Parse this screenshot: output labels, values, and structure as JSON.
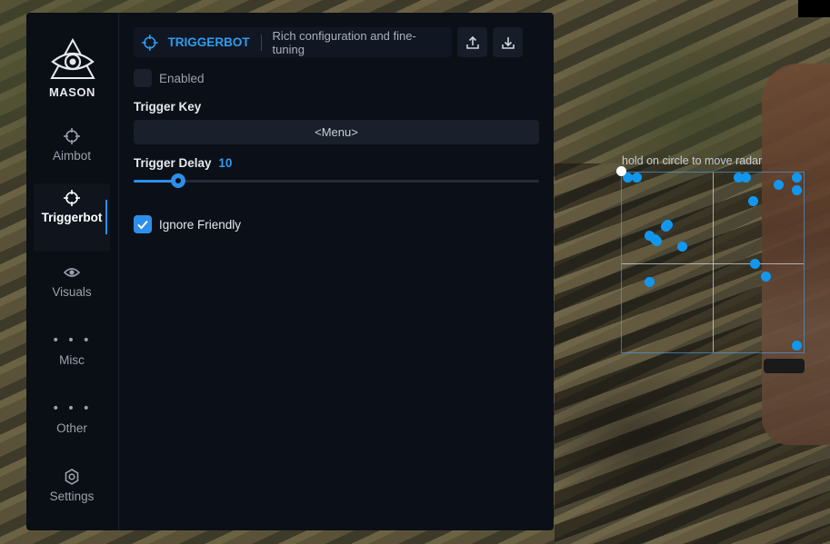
{
  "app": {
    "name": "MASON"
  },
  "sidebar": {
    "items": [
      {
        "label": "Aimbot",
        "icon": "crosshair-icon",
        "active": false
      },
      {
        "label": "Triggerbot",
        "icon": "crosshair-icon",
        "active": true
      },
      {
        "label": "Visuals",
        "icon": "eye-icon",
        "active": false
      },
      {
        "label": "Misc",
        "icon": "dots-icon",
        "active": false
      },
      {
        "label": "Other",
        "icon": "dots-icon",
        "active": false
      },
      {
        "label": "Settings",
        "icon": "gear-icon",
        "active": false
      }
    ]
  },
  "header": {
    "title": "TRIGGERBOT",
    "subtitle": "Rich configuration and fine-tuning",
    "upload_icon": "upload-icon",
    "download_icon": "download-icon"
  },
  "settings": {
    "enabled": {
      "label": "Enabled",
      "checked": false
    },
    "trigger_key": {
      "label": "Trigger Key",
      "value": "<Menu>"
    },
    "trigger_delay": {
      "label": "Trigger Delay",
      "value": "10",
      "fraction": 0.11
    },
    "ignore_friendly": {
      "label": "Ignore Friendly",
      "checked": true
    }
  },
  "radar": {
    "hint": "hold on circle to move radar",
    "accent": "#1297ee",
    "blips": [
      [
        0.03,
        0.03
      ],
      [
        0.08,
        0.03
      ],
      [
        0.64,
        0.03
      ],
      [
        0.68,
        0.03
      ],
      [
        0.86,
        0.07
      ],
      [
        0.96,
        0.03
      ],
      [
        0.96,
        0.1
      ],
      [
        0.72,
        0.16
      ],
      [
        0.25,
        0.29
      ],
      [
        0.24,
        0.3
      ],
      [
        0.15,
        0.35
      ],
      [
        0.18,
        0.37
      ],
      [
        0.19,
        0.38
      ],
      [
        0.33,
        0.41
      ],
      [
        0.73,
        0.51
      ],
      [
        0.79,
        0.58
      ],
      [
        0.15,
        0.61
      ],
      [
        0.96,
        0.96
      ]
    ]
  },
  "colors": {
    "accent": "#2d8fea",
    "panel": "#0b0f17"
  }
}
